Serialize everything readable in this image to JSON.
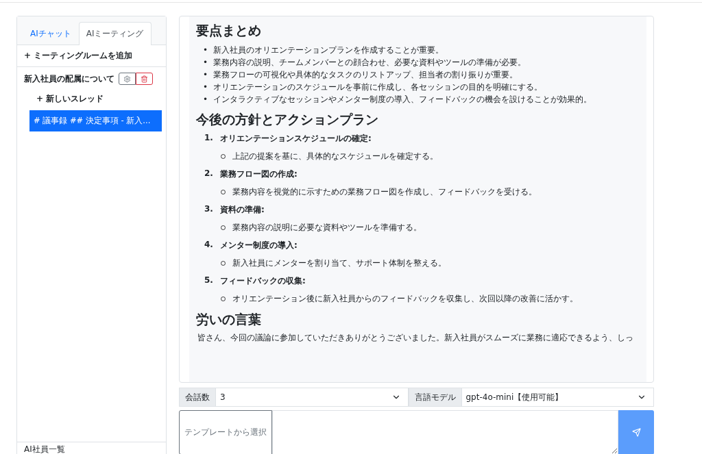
{
  "sidebar": {
    "tabs": [
      {
        "label": "AIチャット",
        "selected": false
      },
      {
        "label": "AIミーティング",
        "selected": true
      }
    ],
    "add_room": "+ ミーティングルームを追加",
    "rooms": [
      {
        "name": "新入社員の配属について",
        "new_thread": "+ 新しいスレッド",
        "threads": [
          {
            "label": "# 議事録 ## 決定事項 - 新入...",
            "selected": true
          }
        ]
      }
    ],
    "footer": "AI社員一覧"
  },
  "message": {
    "sections": [
      {
        "kind": "bullets",
        "heading": "要点まとめ",
        "marker": "•",
        "items": [
          "新入社員のオリエンテーションプランを作成することが重要。",
          "業務内容の説明、チームメンバーとの顔合わせ、必要な資料やツールの準備が必要。",
          "業務フローの可視化や具体的なタスクのリストアップ、担当者の割り振りが重要。",
          "オリエンテーションのスケジュールを事前に作成し、各セッションの目的を明確にする。",
          "インタラクティブなセッションやメンター制度の導入、フィードバックの機会を設けることが効果的。"
        ]
      },
      {
        "kind": "numbered",
        "heading": "今後の方針とアクションプラン",
        "items": [
          {
            "number": "1.",
            "title": "オリエンテーションスケジュールの確定:",
            "detail": "上記の提案を基に、具体的なスケジュールを確定する。"
          },
          {
            "number": "2.",
            "title": "業務フロー図の作成:",
            "detail": "業務内容を視覚的に示すための業務フロー図を作成し、フィードバックを受ける。"
          },
          {
            "number": "3.",
            "title": "資料の準備:",
            "detail": "業務内容の説明に必要な資料やツールを準備する。"
          },
          {
            "number": "4.",
            "title": "メンター制度の導入:",
            "detail": "新入社員にメンターを割り当て、サポート体制を整える。"
          },
          {
            "number": "5.",
            "title": "フィードバックの収集:",
            "detail": "オリエンテーション後に新入社員からのフィードバックを収集し、次回以降の改善に活かす。"
          }
        ]
      },
      {
        "kind": "paragraph",
        "heading": "労いの言葉",
        "text": "皆さん、今回の議論に参加していただきありがとうございました。新入社員がスムーズに業務に適応できるよう、しっ"
      }
    ]
  },
  "controls": {
    "turns": {
      "label": "会話数",
      "value": "3"
    },
    "model": {
      "label": "言語モデル",
      "value": "gpt-4o-mini【使用可能】"
    },
    "template": "テンプレートから選択"
  }
}
